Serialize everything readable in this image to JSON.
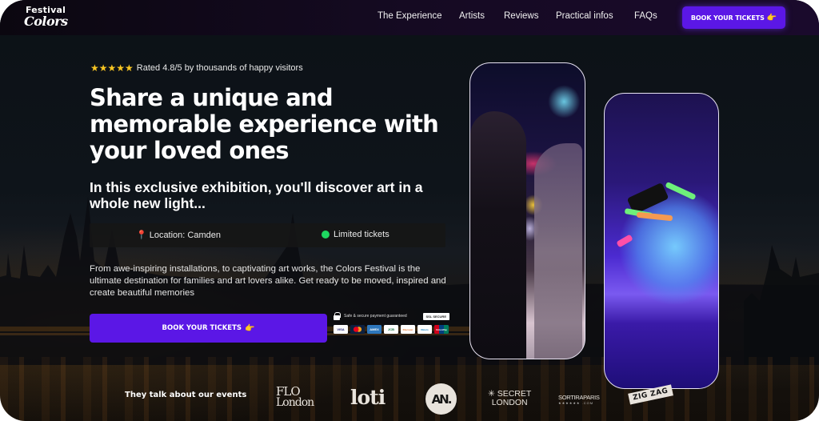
{
  "brand": {
    "line1": "Festival",
    "line2": "Colors"
  },
  "nav": {
    "items": [
      {
        "label": "The Experience"
      },
      {
        "label": "Artists"
      },
      {
        "label": "Reviews"
      },
      {
        "label": "Practical infos"
      },
      {
        "label": "FAQs"
      }
    ],
    "cta_label": "BOOK YOUR TICKETS",
    "cta_icon": "👉"
  },
  "hero": {
    "stars": "★★★★★",
    "star_count": 5,
    "rating_text": "Rated 4.8/5 by thousands of happy visitors",
    "headline": "Share a unique and memorable experience with your loved ones",
    "subheadline": "In this exclusive exhibition, you'll discover art in a whole new light...",
    "location_icon": "📍",
    "location": "Location: Camden",
    "availability": "Limited tickets",
    "availability_color": "#1ed760",
    "description": "From awe-inspiring installations, to captivating art works, the Colors Festival is the ultimate destination for families and art lovers alike. Get ready to be moved, inspired and create beautiful memories",
    "cta_label": "BOOK YOUR TICKETS",
    "cta_icon": "👉",
    "secure_text": "Safe & secure payment guaranteed",
    "ssl_badge": "SSL SECURE",
    "payment_cards": [
      "VISA",
      "Mastercard",
      "AMEX",
      "JCB",
      "Discover",
      "Diners",
      "UnionPay"
    ]
  },
  "press": {
    "label": "They talk about our events",
    "logos": {
      "flo_top": "FLO",
      "flo_bottom": "London",
      "loti": "loti",
      "an": "AN.",
      "secret_top": "✳ SECRET",
      "secret_bottom": "LONDON",
      "sortir": "SORTIRAPARIS",
      "sortir_sub": "★★★★★★ .COM",
      "zigzag": "ZIG ZAG"
    }
  },
  "colors": {
    "accent": "#5b17e6",
    "star": "#f9c623",
    "pin": "#ff2e8a"
  }
}
